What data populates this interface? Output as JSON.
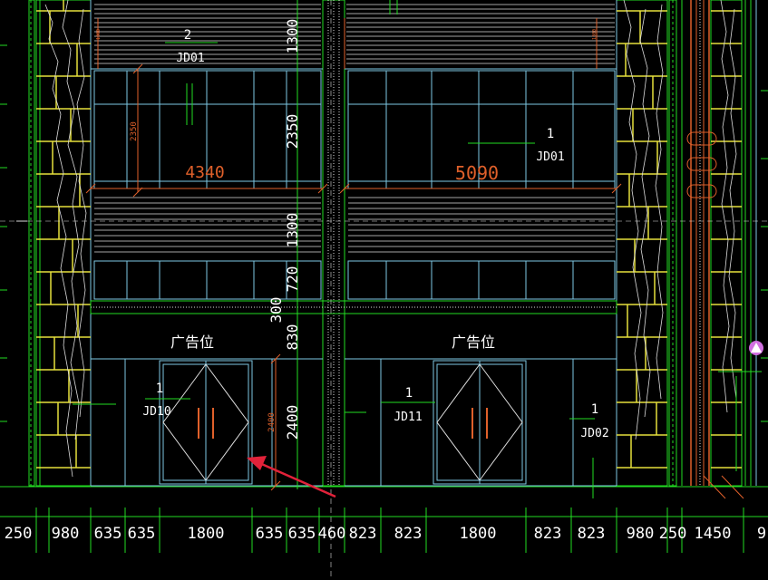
{
  "colors": {
    "background": "#000000",
    "facade_line": "#7ec8e3",
    "dimension_orange": "#e0602a",
    "dimension_white": "#ffffff",
    "axis_green": "#22dd22",
    "wall_yellow": "#e6e03c",
    "hatch_white": "#dddddd",
    "arrow_red": "#e2223a",
    "pipe_orange": "#e0602a",
    "marker_magenta": "#d070e0"
  },
  "upper_labels": {
    "left_number": "2",
    "left_code": "JD01",
    "right_number": "1",
    "right_code": "JD01"
  },
  "vertical_dims": {
    "d1300_top": "1300",
    "d2350": "2350",
    "d1300_mid": "1300",
    "d720": "720",
    "d300": "300",
    "d830": "830",
    "d2400": "2400",
    "small_2350": "2350",
    "small_2400": "2400",
    "small_1300_left": "1300",
    "small_1300_right": "1300"
  },
  "width_dims": {
    "left": "4340",
    "right": "5090"
  },
  "signs": {
    "left": "广告位",
    "right": "广告位"
  },
  "door_labels": {
    "left_number": "1",
    "left_code": "JD10",
    "mid_number": "1",
    "mid_code": "JD11",
    "right_number": "1",
    "right_code": "JD02"
  },
  "bottom_dims": [
    "250",
    "980",
    "635",
    "635",
    "1800",
    "635",
    "635",
    "460",
    "823",
    "823",
    "1800",
    "823",
    "823",
    "980",
    "250",
    "1450",
    "9"
  ]
}
